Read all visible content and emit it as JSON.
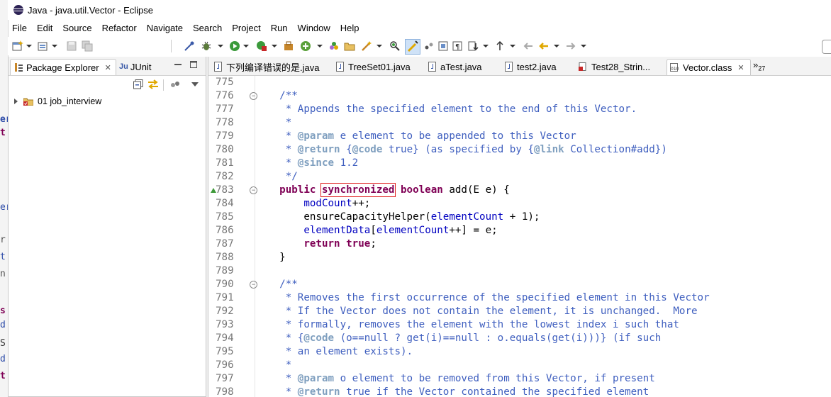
{
  "window": {
    "title": "Java - java.util.Vector - Eclipse"
  },
  "menu": [
    "File",
    "Edit",
    "Source",
    "Refactor",
    "Navigate",
    "Search",
    "Project",
    "Run",
    "Window",
    "Help"
  ],
  "left_panel": {
    "tabs": [
      {
        "label": "Package Explorer",
        "active": true
      },
      {
        "label": "JUnit",
        "active": false
      }
    ],
    "tree": [
      {
        "label": "01 job_interview",
        "expanded": false
      }
    ]
  },
  "editor": {
    "tabs": [
      {
        "label": "下列编译错误的是.java",
        "active": false
      },
      {
        "label": "TreeSet01.java",
        "active": false
      },
      {
        "label": "aTest.java",
        "active": false
      },
      {
        "label": "test2.java",
        "active": false
      },
      {
        "label": "Test28_Strin...",
        "active": false
      },
      {
        "label": "Vector.class",
        "active": true
      }
    ],
    "overflow_count": "27",
    "lines": [
      {
        "no": "775",
        "segments": []
      },
      {
        "no": "776",
        "fold": true,
        "segments": [
          {
            "t": "    ",
            "c": "default"
          },
          {
            "t": "/**",
            "c": "doc"
          }
        ]
      },
      {
        "no": "777",
        "segments": [
          {
            "t": "     * Appends the specified element to the end of this Vector.",
            "c": "doc"
          }
        ]
      },
      {
        "no": "778",
        "segments": [
          {
            "t": "     *",
            "c": "doc"
          }
        ]
      },
      {
        "no": "779",
        "segments": [
          {
            "t": "     * ",
            "c": "doc"
          },
          {
            "t": "@param",
            "c": "tag"
          },
          {
            "t": " e element to be appended to this Vector",
            "c": "doc"
          }
        ]
      },
      {
        "no": "780",
        "segments": [
          {
            "t": "     * ",
            "c": "doc"
          },
          {
            "t": "@return",
            "c": "tag"
          },
          {
            "t": " {",
            "c": "doc"
          },
          {
            "t": "@code",
            "c": "tag"
          },
          {
            "t": " true} (as specified by {",
            "c": "doc"
          },
          {
            "t": "@link",
            "c": "tag"
          },
          {
            "t": " Collection#add})",
            "c": "doc"
          }
        ]
      },
      {
        "no": "781",
        "segments": [
          {
            "t": "     * ",
            "c": "doc"
          },
          {
            "t": "@since",
            "c": "tag"
          },
          {
            "t": " 1.2",
            "c": "doc"
          }
        ]
      },
      {
        "no": "782",
        "segments": [
          {
            "t": "     */",
            "c": "doc"
          }
        ]
      },
      {
        "no": "783",
        "fold": true,
        "override": true,
        "segments": [
          {
            "t": "    ",
            "c": "default"
          },
          {
            "t": "public",
            "c": "kw"
          },
          {
            "t": " ",
            "c": "default"
          },
          {
            "t": "synchronized",
            "c": "kw",
            "highlight": true
          },
          {
            "t": " ",
            "c": "default"
          },
          {
            "t": "boolean",
            "c": "kw"
          },
          {
            "t": " add(E e) {",
            "c": "default"
          }
        ]
      },
      {
        "no": "784",
        "segments": [
          {
            "t": "        ",
            "c": "default"
          },
          {
            "t": "modCount",
            "c": "field"
          },
          {
            "t": "++;",
            "c": "default"
          }
        ]
      },
      {
        "no": "785",
        "segments": [
          {
            "t": "        ensureCapacityHelper(",
            "c": "default"
          },
          {
            "t": "elementCount",
            "c": "field"
          },
          {
            "t": " + 1);",
            "c": "default"
          }
        ]
      },
      {
        "no": "786",
        "segments": [
          {
            "t": "        ",
            "c": "default"
          },
          {
            "t": "elementData",
            "c": "field"
          },
          {
            "t": "[",
            "c": "default"
          },
          {
            "t": "elementCount",
            "c": "field"
          },
          {
            "t": "++] = e;",
            "c": "default"
          }
        ]
      },
      {
        "no": "787",
        "segments": [
          {
            "t": "        ",
            "c": "default"
          },
          {
            "t": "return",
            "c": "kw"
          },
          {
            "t": " ",
            "c": "default"
          },
          {
            "t": "true",
            "c": "kw"
          },
          {
            "t": ";",
            "c": "default"
          }
        ]
      },
      {
        "no": "788",
        "segments": [
          {
            "t": "    }",
            "c": "default"
          }
        ]
      },
      {
        "no": "789",
        "segments": []
      },
      {
        "no": "790",
        "fold": true,
        "segments": [
          {
            "t": "    ",
            "c": "default"
          },
          {
            "t": "/**",
            "c": "doc"
          }
        ]
      },
      {
        "no": "791",
        "segments": [
          {
            "t": "     * Removes the first occurrence of the specified element in this Vector",
            "c": "doc"
          }
        ]
      },
      {
        "no": "792",
        "segments": [
          {
            "t": "     * If the Vector does not contain the element, it is unchanged.  More",
            "c": "doc"
          }
        ]
      },
      {
        "no": "793",
        "segments": [
          {
            "t": "     * formally, removes the element with the lowest index i such that",
            "c": "doc"
          }
        ]
      },
      {
        "no": "794",
        "segments": [
          {
            "t": "     * {",
            "c": "doc"
          },
          {
            "t": "@code",
            "c": "tag"
          },
          {
            "t": " (o==null ? get(i)==null : o.equals(get(i)))} (if such",
            "c": "doc"
          }
        ]
      },
      {
        "no": "795",
        "segments": [
          {
            "t": "     * an element exists).",
            "c": "doc"
          }
        ]
      },
      {
        "no": "796",
        "segments": [
          {
            "t": "     *",
            "c": "doc"
          }
        ]
      },
      {
        "no": "797",
        "segments": [
          {
            "t": "     * ",
            "c": "doc"
          },
          {
            "t": "@param",
            "c": "tag"
          },
          {
            "t": " o element to be removed from this Vector, if present",
            "c": "doc"
          }
        ]
      },
      {
        "no": "798",
        "segments": [
          {
            "t": "     * ",
            "c": "doc"
          },
          {
            "t": "@return",
            "c": "tag"
          },
          {
            "t": " true if the Vector contained the specified element",
            "c": "doc"
          }
        ]
      }
    ]
  },
  "background_window_fragments": [
    "er",
    "t",
    "er",
    "r",
    "t",
    "n",
    "s",
    "d",
    "S",
    "d",
    "t"
  ],
  "colors": {
    "keyword": "#7f0055",
    "javadoc": "#3f5fbf",
    "javadoc_tag": "#7f9fbf",
    "field": "#0000c0",
    "line_number": "#787878",
    "highlight_box": "#e02020"
  }
}
